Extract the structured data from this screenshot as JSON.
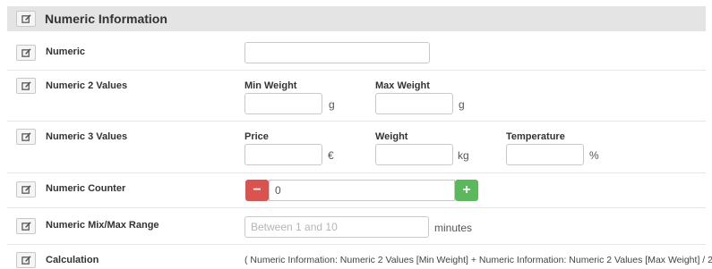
{
  "section": {
    "title": "Numeric Information"
  },
  "rows": {
    "numeric": {
      "label": "Numeric",
      "value": ""
    },
    "numeric2": {
      "label": "Numeric 2 Values",
      "fields": [
        {
          "label": "Min Weight",
          "value": "",
          "unit": "g"
        },
        {
          "label": "Max Weight",
          "value": "",
          "unit": "g"
        }
      ]
    },
    "numeric3": {
      "label": "Numeric 3 Values",
      "fields": [
        {
          "label": "Price",
          "value": "",
          "unit": "€"
        },
        {
          "label": "Weight",
          "value": "",
          "unit": "kg"
        },
        {
          "label": "Temperature",
          "value": "",
          "unit": "%"
        }
      ]
    },
    "counter": {
      "label": "Numeric Counter",
      "value": "0",
      "minus": "−",
      "plus": "+"
    },
    "range": {
      "label": "Numeric Mix/Max Range",
      "placeholder": "Between 1 and 10",
      "unit": "minutes"
    },
    "calculation": {
      "label": "Calculation",
      "formula": "( Numeric Information: Numeric 2 Values [Min Weight] + Numeric Information: Numeric 2 Values [Max Weight] / 2"
    }
  },
  "colors": {
    "header_bg": "#e4e4e4",
    "minus": "#d9534f",
    "plus": "#5cb85c"
  }
}
